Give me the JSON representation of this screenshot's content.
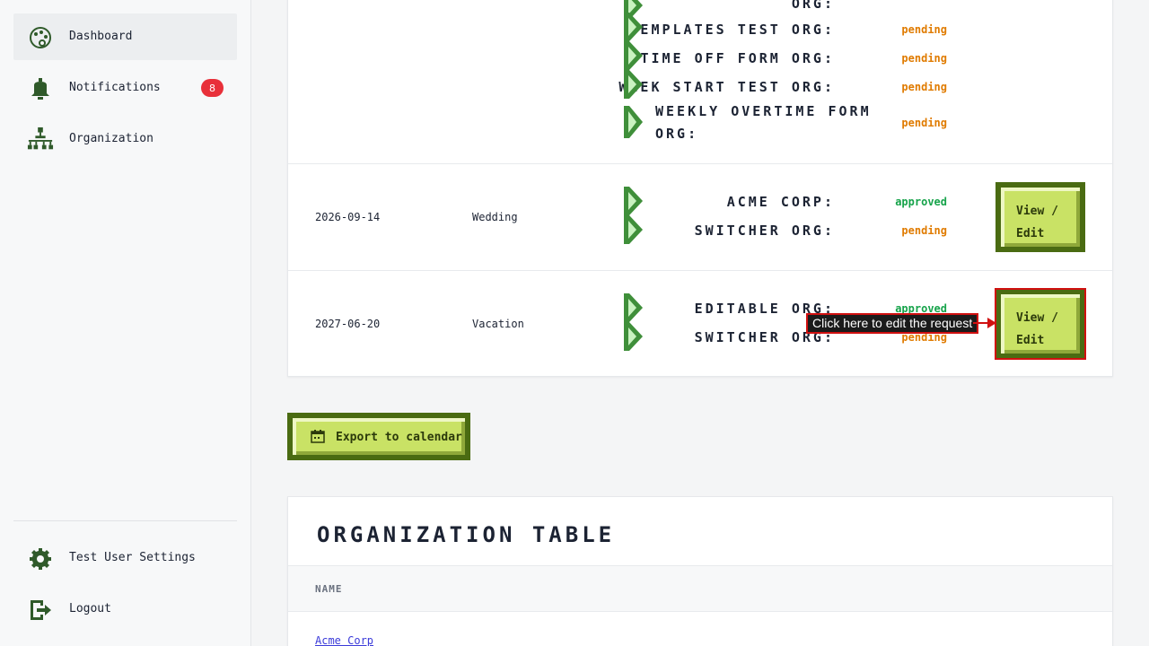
{
  "sidebar": {
    "items": [
      {
        "label": "Dashboard",
        "icon": "palette-icon"
      },
      {
        "label": "Notifications",
        "icon": "bell-icon",
        "badge": "8"
      },
      {
        "label": "Organization",
        "icon": "org-chart-icon"
      }
    ],
    "bottom": [
      {
        "label": "Test User Settings",
        "icon": "gear-icon"
      },
      {
        "label": "Logout",
        "icon": "logout-icon"
      }
    ]
  },
  "requests": {
    "row0_orgs": [
      {
        "name": "Org:",
        "status": ""
      },
      {
        "name": "Templates Test Org:",
        "status": "pending"
      },
      {
        "name": "Time Off Form Org:",
        "status": "pending"
      },
      {
        "name": "Week Start Test Org:",
        "status": "pending"
      },
      {
        "name": "Weekly Overtime Form",
        "name2": "Org:",
        "status": "pending"
      }
    ],
    "rows": [
      {
        "date": "2026-09-14",
        "type": "Wedding",
        "orgs": [
          {
            "name": "Acme Corp:",
            "status": "approved"
          },
          {
            "name": "Switcher Org:",
            "status": "pending"
          }
        ],
        "button": {
          "line1": "View /",
          "line2": "Edit"
        }
      },
      {
        "date": "2027-06-20",
        "type": "Vacation",
        "orgs": [
          {
            "name": "Editable Org:",
            "status": "approved"
          },
          {
            "name": "Switcher Org:",
            "status": "pending"
          }
        ],
        "button": {
          "line1": "View /",
          "line2": "Edit"
        }
      }
    ]
  },
  "tooltip": "Click here to edit the request",
  "export_button": "Export to calendar",
  "org_table": {
    "title": "Organization Table",
    "header_name": "Name",
    "rows": [
      "Acme Corp"
    ]
  },
  "colors": {
    "accent": "#c9e265",
    "border": "#4a6b12",
    "pending": "#e07b00",
    "approved": "#16a34a",
    "badge": "#e8303a"
  }
}
